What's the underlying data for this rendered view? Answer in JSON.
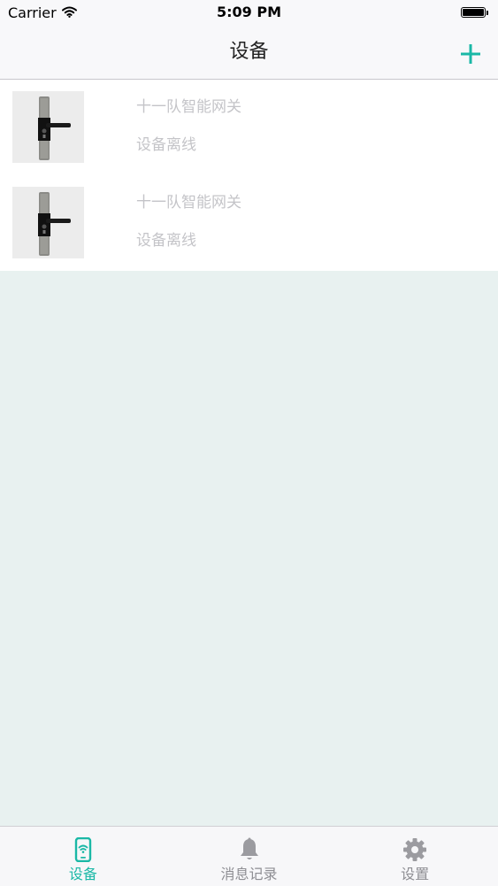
{
  "status_bar": {
    "carrier": "Carrier",
    "time": "5:09 PM",
    "battery_level": 1.0
  },
  "nav": {
    "title": "设备",
    "add_icon": "plus-icon"
  },
  "devices": [
    {
      "name": "十一队智能网关",
      "status": "设备离线",
      "thumbnail": "door-lock-image"
    },
    {
      "name": "十一队智能网关",
      "status": "设备离线",
      "thumbnail": "door-lock-image"
    }
  ],
  "tabs": [
    {
      "label": "设备",
      "icon": "phone-wifi-icon",
      "active": true
    },
    {
      "label": "消息记录",
      "icon": "bell-icon",
      "active": false
    },
    {
      "label": "设置",
      "icon": "gear-icon",
      "active": false
    }
  ],
  "colors": {
    "accent": "#1ab8a6",
    "inactive_tab": "#8e8e93",
    "content_background": "#e8f1f0",
    "offline_text": "#c4c4c8"
  }
}
